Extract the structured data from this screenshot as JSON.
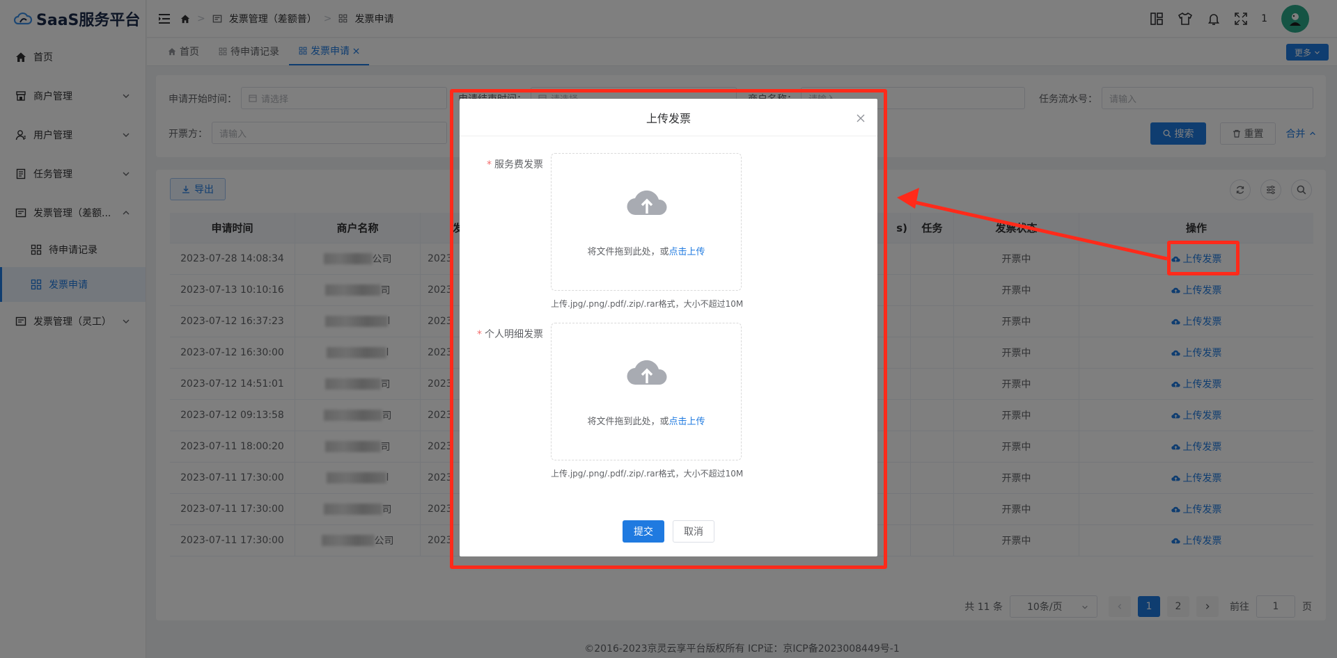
{
  "app": {
    "title": "SaaS服务平台"
  },
  "sidebar": {
    "items": [
      {
        "label": "首页",
        "icon": "home-icon"
      },
      {
        "label": "商户管理",
        "icon": "shop-icon"
      },
      {
        "label": "用户管理",
        "icon": "user-icon"
      },
      {
        "label": "任务管理",
        "icon": "task-icon"
      },
      {
        "label": "发票管理（差额...",
        "icon": "invoice-icon"
      },
      {
        "label": "待申请记录",
        "icon": "grid-icon"
      },
      {
        "label": "发票申请",
        "icon": "grid-icon"
      },
      {
        "label": "发票管理（灵工）",
        "icon": "invoice-icon"
      }
    ]
  },
  "header": {
    "breadcrumb": [
      "发票管理（差额普）",
      "发票申请"
    ],
    "notification_count": "1"
  },
  "tabs": {
    "items": [
      {
        "label": "首页"
      },
      {
        "label": "待申请记录"
      },
      {
        "label": "发票申请"
      }
    ],
    "more_label": "更多"
  },
  "filter": {
    "start_time_label": "申请开始时间：",
    "start_time_placeholder": "请选择",
    "end_time_label": "申请结束时间：",
    "end_time_placeholder": "请选择",
    "merchant_label": "商户名称：",
    "merchant_placeholder": "请输入",
    "task_no_label": "任务流水号：",
    "task_no_placeholder": "请输入",
    "issuer_label": "开票方：",
    "issuer_placeholder": "请输入",
    "search_label": "搜索",
    "reset_label": "重置",
    "collapse_label": "合并"
  },
  "table": {
    "export_label": "导出",
    "headers": [
      "申请时间",
      "商户名称",
      "发",
      "s)",
      "任务",
      "发票状态",
      "操作"
    ],
    "rows": [
      {
        "time": "2023-07-28 14:08:34",
        "name_suffix": "公司",
        "date": "2023",
        "status": "开票中",
        "op": "上传发票"
      },
      {
        "time": "2023-07-13 10:10:16",
        "name_suffix": "司",
        "date": "2023",
        "status": "开票中",
        "op": "上传发票"
      },
      {
        "time": "2023-07-12 16:37:23",
        "name_suffix": "l",
        "date": "2023",
        "status": "开票中",
        "op": "上传发票"
      },
      {
        "time": "2023-07-12 16:30:00",
        "name_suffix": "l",
        "date": "2023",
        "status": "开票中",
        "op": "上传发票"
      },
      {
        "time": "2023-07-12 14:51:01",
        "name_suffix": "司",
        "date": "2023",
        "status": "开票中",
        "op": "上传发票"
      },
      {
        "time": "2023-07-12 09:13:58",
        "name_suffix": "司",
        "date": "2023",
        "status": "开票中",
        "op": "上传发票"
      },
      {
        "time": "2023-07-11 18:00:20",
        "name_suffix": "司",
        "date": "2023",
        "status": "开票中",
        "op": "上传发票"
      },
      {
        "time": "2023-07-11 17:30:00",
        "name_suffix": "l",
        "date": "2023",
        "status": "开票中",
        "op": "上传发票"
      },
      {
        "time": "2023-07-11 17:30:00",
        "name_suffix": "司",
        "date": "2023",
        "status": "开票中",
        "op": "上传发票"
      },
      {
        "time": "2023-07-11 17:30:00",
        "name_suffix": "公司",
        "date": "2023",
        "status": "开票中",
        "op": "上传发票"
      }
    ]
  },
  "pagination": {
    "total": "共 11 条",
    "page_size": "10条/页",
    "pages": [
      "1",
      "2"
    ],
    "goto_label": "前往",
    "goto_value": "1",
    "page_unit": "页"
  },
  "footer": {
    "text": "©2016-2023京灵云享平台版权所有 ICP证：京ICP备2023008449号-1"
  },
  "dialog": {
    "title": "上传发票",
    "field1_label": "服务费发票",
    "field2_label": "个人明细发票",
    "upload_text": "将文件拖到此处，或",
    "upload_link": "点击上传",
    "upload_tip": "上传.jpg/.png/.pdf/.zip/.rar格式，大小不超过10M",
    "submit_label": "提交",
    "cancel_label": "取消"
  },
  "colors": {
    "primary": "#1f7ae0",
    "annotation": "#ff2a1a",
    "danger": "#f56c6c"
  }
}
